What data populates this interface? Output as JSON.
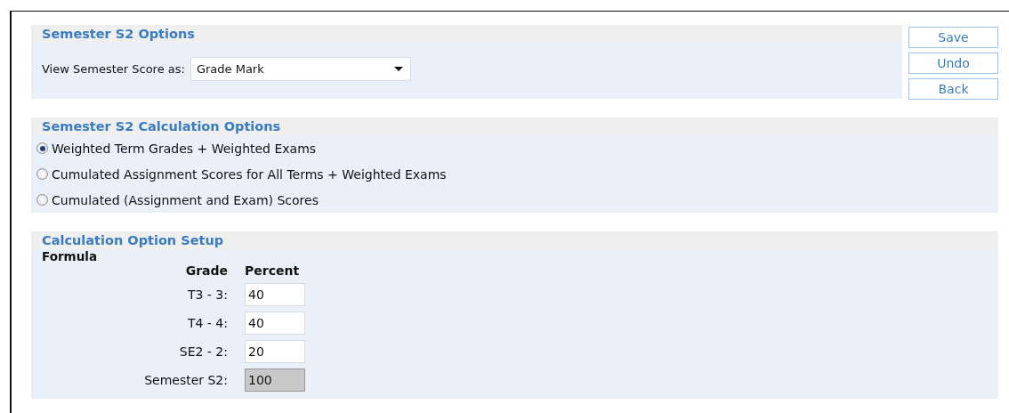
{
  "options": {
    "title": "Semester S2 Options",
    "view_label": "View Semester Score as:",
    "view_select": {
      "value": "Grade Mark"
    }
  },
  "buttons": [
    {
      "label": "Save"
    },
    {
      "label": "Undo"
    },
    {
      "label": "Back"
    }
  ],
  "calculation_options": {
    "title": "Semester S2 Calculation Options",
    "items": [
      {
        "label": "Weighted Term Grades + Weighted Exams",
        "selected": true
      },
      {
        "label": "Cumulated Assignment Scores for All Terms + Weighted Exams",
        "selected": false
      },
      {
        "label": "Cumulated (Assignment and Exam) Scores",
        "selected": false
      }
    ]
  },
  "setup": {
    "title": "Calculation Option Setup",
    "subtitle": "Formula",
    "columns": [
      "Grade",
      "Percent"
    ],
    "rows": [
      {
        "grade": "T3 - 3:",
        "percent": "40",
        "disabled": false
      },
      {
        "grade": "T4 - 4:",
        "percent": "40",
        "disabled": false
      },
      {
        "grade": "SE2 - 2:",
        "percent": "20",
        "disabled": false
      },
      {
        "grade": "Semester S2:",
        "percent": "100",
        "disabled": true
      }
    ]
  }
}
